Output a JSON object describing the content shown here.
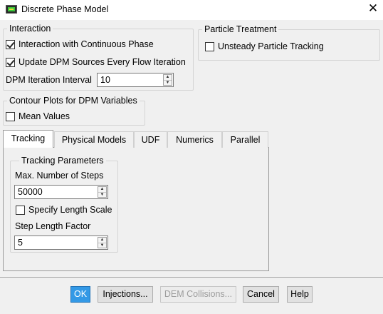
{
  "window": {
    "title": "Discrete Phase Model",
    "close_glyph": "✕",
    "icon": "fluent-app-icon"
  },
  "interaction": {
    "legend": "Interaction",
    "continuous_phase": {
      "label": "Interaction with Continuous Phase",
      "checked": true
    },
    "update_sources": {
      "label": "Update DPM Sources Every Flow Iteration",
      "checked": true
    },
    "iteration_interval": {
      "label": "DPM Iteration Interval",
      "value": "10"
    }
  },
  "particle_treatment": {
    "legend": "Particle Treatment",
    "unsteady": {
      "label": "Unsteady Particle Tracking",
      "checked": false
    }
  },
  "contour_plots": {
    "legend": "Contour Plots for DPM Variables",
    "mean_values": {
      "label": "Mean Values",
      "checked": false
    }
  },
  "tabs": [
    {
      "label": "Tracking",
      "active": true
    },
    {
      "label": "Physical Models",
      "active": false
    },
    {
      "label": "UDF",
      "active": false
    },
    {
      "label": "Numerics",
      "active": false
    },
    {
      "label": "Parallel",
      "active": false
    }
  ],
  "tracking": {
    "legend": "Tracking Parameters",
    "max_steps": {
      "label": "Max. Number of Steps",
      "value": "50000"
    },
    "specify_length_scale": {
      "label": "Specify Length Scale",
      "checked": false
    },
    "step_length_factor": {
      "label": "Step Length Factor",
      "value": "5"
    }
  },
  "buttons": {
    "ok": "OK",
    "injections": "Injections...",
    "dem_collisions": "DEM Collisions...",
    "cancel": "Cancel",
    "help": "Help"
  },
  "colors": {
    "accent": "#3399e6",
    "window_bg": "#f0f0f0"
  }
}
